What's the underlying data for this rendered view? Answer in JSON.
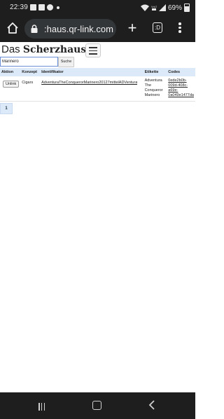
{
  "status_bar": {
    "time": "22:39",
    "battery": "69%",
    "notification_icons": [
      "image-icon",
      "gallery-icon",
      "whatsapp-icon",
      "dot-icon"
    ],
    "system_icons": [
      "wifi-icon",
      "volte-icon",
      "signal-icon",
      "battery-icon"
    ]
  },
  "browser": {
    "url": ":haus.qr-link.com",
    "tab_count": ":D"
  },
  "site": {
    "brand_light": "Das ",
    "brand_bold": "Scherzhaus"
  },
  "search": {
    "value": "Marinero",
    "button_label": "Suche"
  },
  "table": {
    "headers": {
      "aktion": "Aktion",
      "konzept": "Konzept",
      "identifikator": "Identifikator",
      "etikette": "Etikette",
      "codes": "Codes"
    },
    "rows": [
      {
        "action_label": "Unlink",
        "konzept": "Cigars",
        "identifikator": "AdventuraTheConquerorMarinero20127mittelADVentura",
        "etikette_lines": [
          "Adventura",
          "The",
          "Conqueror",
          "Marinero"
        ],
        "code_lines": [
          "0ede2b0b-",
          "009d-408c-",
          "a69e-",
          "0a049e1477da"
        ]
      }
    ]
  },
  "pagination": {
    "current_page": "1"
  },
  "colors": {
    "header_bg": "#dbe9f8",
    "chrome_bg": "#1e1e1e",
    "url_box_bg": "#333639"
  }
}
